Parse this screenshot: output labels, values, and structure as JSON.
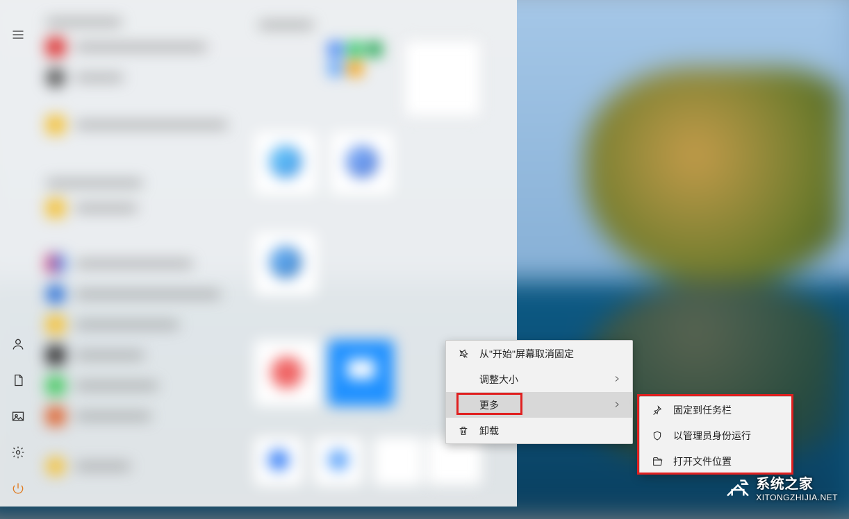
{
  "rail": {
    "menu_btn": "menu",
    "user_btn": "user",
    "documents_btn": "documents",
    "pictures_btn": "pictures",
    "settings_btn": "settings",
    "power_btn": "power"
  },
  "context_menu": {
    "unpin": "从\"开始\"屏幕取消固定",
    "resize": "调整大小",
    "more": "更多",
    "uninstall": "卸载"
  },
  "more_submenu": {
    "pin_taskbar": "固定到任务栏",
    "run_admin": "以管理员身份运行",
    "open_location": "打开文件位置"
  },
  "watermark": {
    "title": "系统之家",
    "url": "XITONGZHIJIA.NET"
  },
  "colors": {
    "highlight": "#e02020",
    "menu_bg": "#f2f2f2"
  }
}
